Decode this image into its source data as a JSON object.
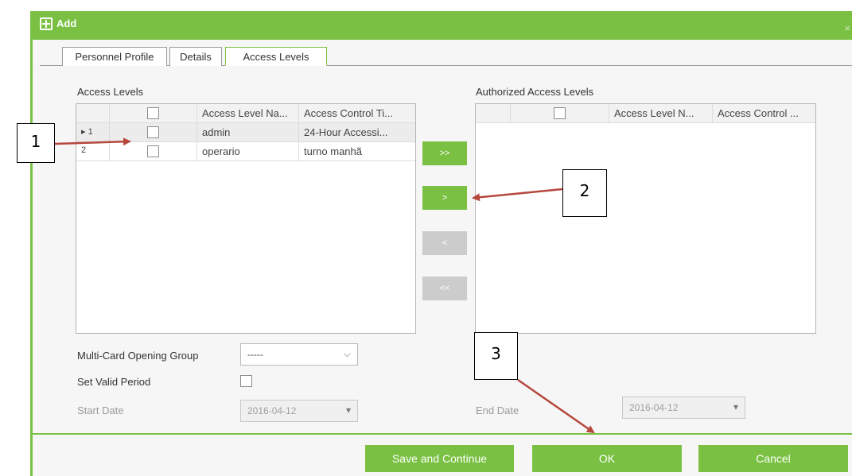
{
  "dialog": {
    "title": "Add",
    "close": "×"
  },
  "tabs": [
    {
      "label": "Personnel Profile"
    },
    {
      "label": "Details"
    },
    {
      "label": "Access Levels"
    }
  ],
  "left_grid": {
    "label": "Access Levels",
    "headers": [
      "",
      "",
      "Access Level Na...",
      "Access Control Ti..."
    ],
    "rows": [
      {
        "num": "▸ 1",
        "name": "admin",
        "time": "24-Hour Accessi..."
      },
      {
        "num": "2",
        "name": "operario",
        "time": "turno manhã"
      }
    ]
  },
  "right_grid": {
    "label": "Authorized Access Levels",
    "headers": [
      "",
      "",
      "Access Level N...",
      "Access Control ..."
    ]
  },
  "move_buttons": {
    "add_all": ">>",
    "add": ">",
    "remove": "<",
    "remove_all": "<<"
  },
  "form": {
    "multi_card_label": "Multi-Card Opening Group",
    "multi_card_value": "-----",
    "valid_period_label": "Set Valid Period",
    "start_date_label": "Start Date",
    "start_date_value": "2016-04-12",
    "end_date_label": "End Date",
    "end_date_value": "2016-04-12"
  },
  "footer": {
    "save_continue": "Save and Continue",
    "ok": "OK",
    "cancel": "Cancel"
  },
  "callouts": [
    "1",
    "2",
    "3"
  ],
  "colors": {
    "accent": "#7ac143",
    "disabled": "#cccccc",
    "arrow": "#b5473c"
  }
}
